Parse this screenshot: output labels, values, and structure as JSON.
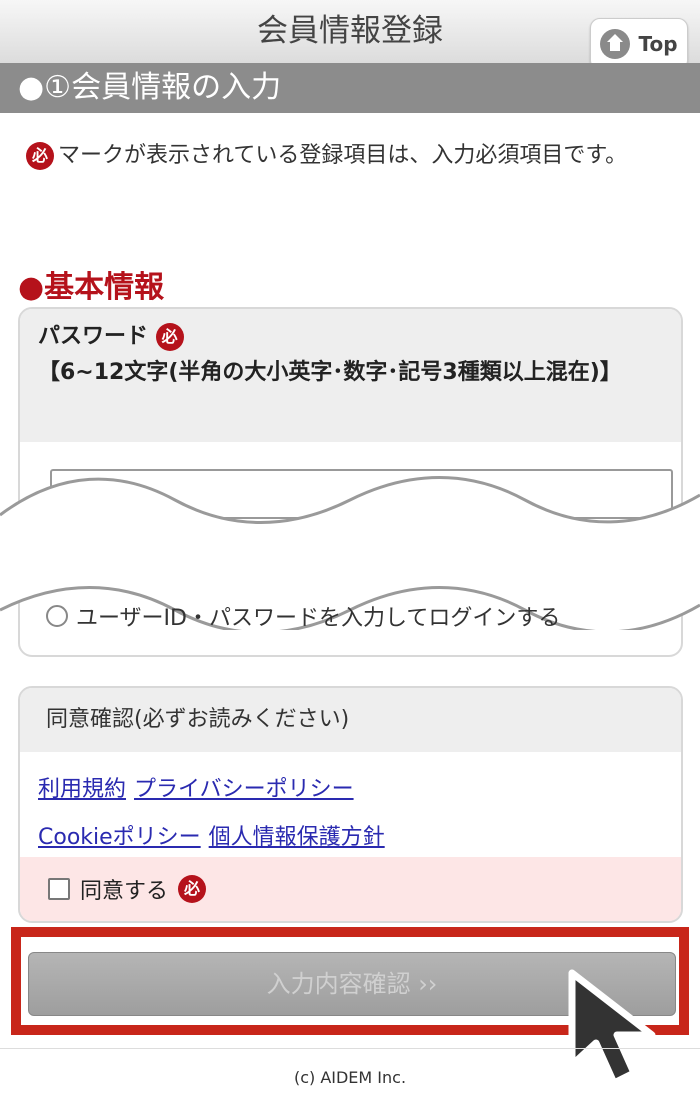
{
  "header": {
    "title": "会員情報登録",
    "top_label": "Top"
  },
  "section": {
    "title": "●①会員情報の入力"
  },
  "notice": {
    "badge": "必",
    "text": "マークが表示されている登録項目は、入力必須項目です。"
  },
  "basic": {
    "title": "●基本情報"
  },
  "password": {
    "label": "パスワード",
    "badge": "必",
    "hint": "【6~12文字(半角の大小英字･数字･記号3種類以上混在)】",
    "value": ""
  },
  "option": {
    "radio_label": "ユーザーID・パスワードを入力してログインする"
  },
  "consent": {
    "title": "同意確認(必ずお読みください)",
    "links": [
      "利用規約",
      "プライバシーポリシー",
      "Cookieポリシー",
      "個人情報保護方針"
    ],
    "agree_label": "同意する",
    "badge": "必"
  },
  "confirm_button": {
    "label": "入力内容確認 ››"
  },
  "footer": {
    "copyright": "(c) AIDEM Inc."
  },
  "colors": {
    "required": "#b5121b",
    "highlight": "#c8261a",
    "section_bar": "#8c8c8c"
  }
}
